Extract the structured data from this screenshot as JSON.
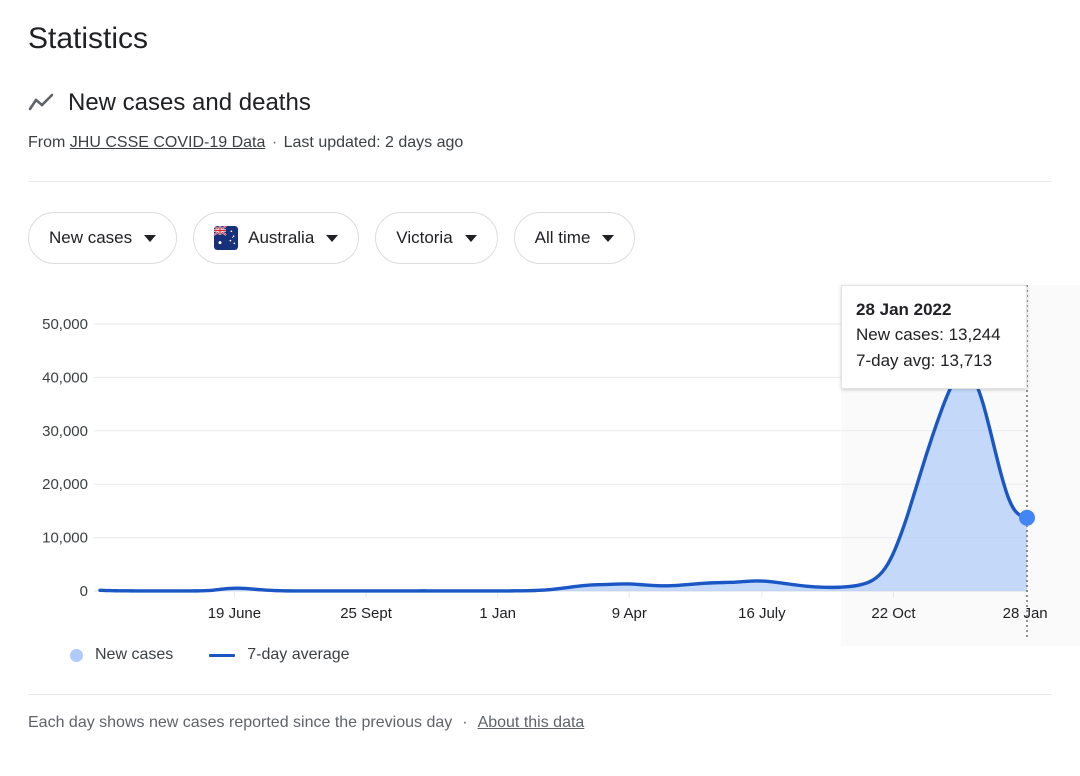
{
  "header": {
    "page_title": "Statistics",
    "section_icon": "trend-line-icon",
    "section_title": "New cases and deaths",
    "source_prefix": "From",
    "source_link": "JHU CSSE COVID-19 Data",
    "source_separator": "·",
    "last_updated": "Last updated: 2 days ago"
  },
  "filters": [
    {
      "label": "New cases",
      "icon": null
    },
    {
      "label": "Australia",
      "icon": "australia-flag-icon"
    },
    {
      "label": "Victoria",
      "icon": null
    },
    {
      "label": "All time",
      "icon": null
    }
  ],
  "tooltip": {
    "date": "28 Jan 2022",
    "new_cases_label": "New cases:",
    "new_cases_value": "13,244",
    "avg_label": "7-day avg:",
    "avg_value": "13,713",
    "new_cases_line": "New cases: 13,244",
    "avg_line": "7-day avg: 13,713"
  },
  "legend": [
    {
      "label": "New cases",
      "marker": "dot",
      "color": "#aecbfa"
    },
    {
      "label": "7-day average",
      "marker": "line",
      "color": "#1a56c4"
    }
  ],
  "footer": {
    "note": "Each day shows new cases reported since the previous day",
    "separator": "·",
    "link": "About this data"
  },
  "colors": {
    "line": "#1a56c4",
    "area": "#aecbfa",
    "marker": "#4285f4",
    "grid": "#e8eaed",
    "chip_border": "#dadce0",
    "text": "#202124",
    "muted_text": "#5f6368"
  },
  "chart_data": {
    "type": "area",
    "title": "New cases and deaths",
    "xlabel": "",
    "ylabel": "",
    "grid": true,
    "legend_position": "bottom-left",
    "ylim": [
      0,
      52000
    ],
    "yticks": [
      "0",
      "10,000",
      "20,000",
      "30,000",
      "40,000",
      "50,000"
    ],
    "ytick_values": [
      0,
      10000,
      20000,
      30000,
      40000,
      50000
    ],
    "xticks": [
      "19 June",
      "25 Sept",
      "1 Jan",
      "9 Apr",
      "16 July",
      "22 Oct",
      "28 Jan"
    ],
    "xtick_positions": [
      0.145,
      0.287,
      0.429,
      0.571,
      0.714,
      0.856,
      0.998
    ],
    "highlight_date": "28 Jan 2022",
    "highlight_value": 13244,
    "highlight_avg": 13713,
    "series": [
      {
        "name": "7-day average",
        "type": "line",
        "color": "#1a56c4",
        "values": [
          120,
          90,
          60,
          40,
          30,
          25,
          20,
          15,
          12,
          10,
          9,
          8,
          8,
          10,
          14,
          22,
          40,
          80,
          160,
          300,
          430,
          500,
          520,
          470,
          380,
          280,
          190,
          120,
          70,
          40,
          25,
          18,
          14,
          12,
          10,
          9,
          8,
          8,
          7,
          7,
          6,
          6,
          5,
          5,
          5,
          6,
          7,
          9,
          12,
          16,
          20,
          22,
          20,
          17,
          14,
          12,
          10,
          9,
          8,
          8,
          8,
          9,
          10,
          12,
          15,
          20,
          28,
          40,
          60,
          95,
          150,
          230,
          340,
          470,
          620,
          780,
          930,
          1050,
          1130,
          1180,
          1210,
          1250,
          1300,
          1330,
          1320,
          1260,
          1170,
          1080,
          1010,
          980,
          980,
          1020,
          1090,
          1180,
          1280,
          1380,
          1460,
          1520,
          1560,
          1590,
          1620,
          1680,
          1760,
          1840,
          1880,
          1860,
          1780,
          1650,
          1500,
          1340,
          1180,
          1030,
          900,
          800,
          730,
          690,
          680,
          700,
          760,
          860,
          1020,
          1280,
          1700,
          2400,
          3500,
          5200,
          7600,
          10600,
          14000,
          17800,
          21600,
          25400,
          29000,
          32400,
          35600,
          38300,
          40200,
          41100,
          40600,
          38600,
          35200,
          30800,
          26000,
          21400,
          17600,
          15200,
          14100,
          13713
        ]
      },
      {
        "name": "New cases",
        "type": "area",
        "color": "#aecbfa",
        "last_value": 13244
      }
    ]
  }
}
